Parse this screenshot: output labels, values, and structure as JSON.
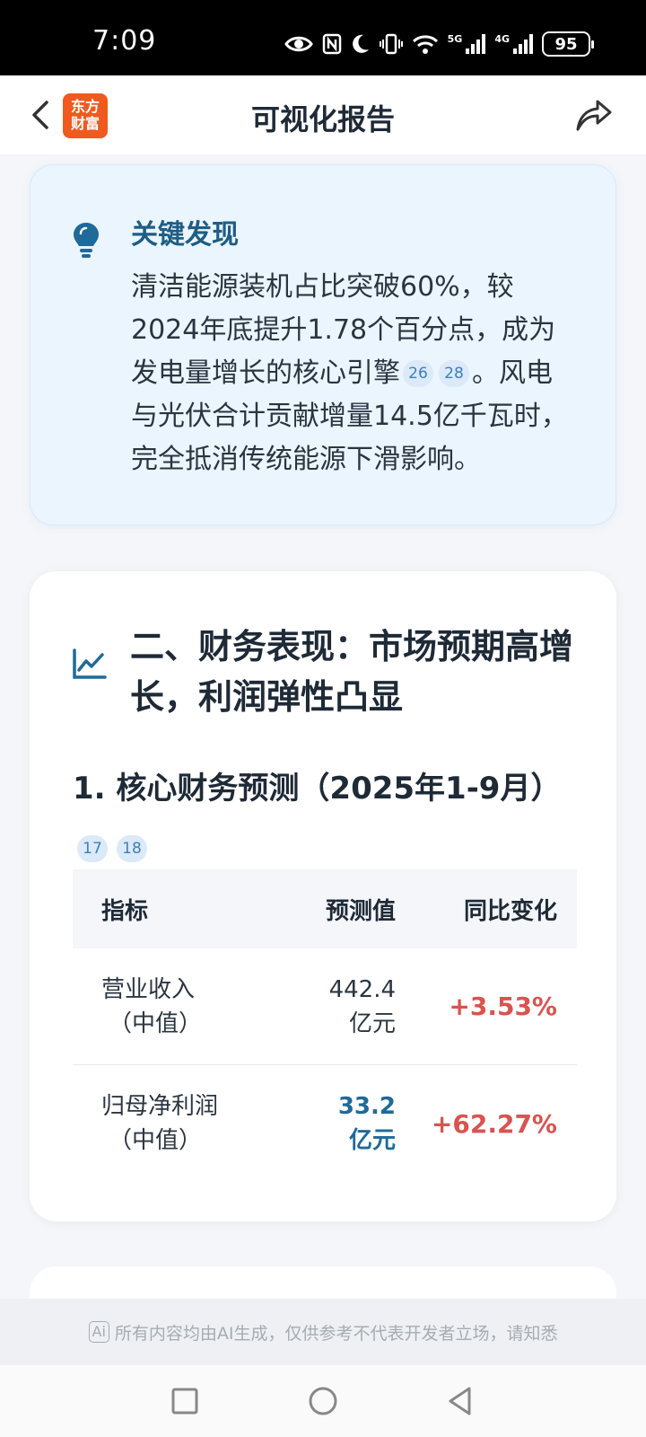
{
  "status_bar": {
    "time": "7:09",
    "signal_1_label": "5G",
    "signal_2_label": "4G",
    "battery": "95"
  },
  "header": {
    "title": "可视化报告",
    "logo_line1": "东方",
    "logo_line2": "财富"
  },
  "key_finding": {
    "title": "关键发现",
    "text_part1": "清洁能源装机占比突破60%，较2024年底提升1.78个百分点，成为发电量增长的核心引擎",
    "citations": [
      "26",
      "28"
    ],
    "text_part2": "。风电与光伏合计贡献增量14.5亿千瓦时，完全抵消传统能源下滑影响。"
  },
  "finance_section": {
    "title": "二、财务表现：市场预期高增长，利润弹性凸显",
    "subtitle": "1. 核心财务预测（2025年1-9月）",
    "citations": [
      "17",
      "18"
    ],
    "table": {
      "headers": [
        "指标",
        "预测值",
        "同比变化"
      ],
      "rows": [
        {
          "metric_line1": "营业收入",
          "metric_line2": "（中值）",
          "value": "442.4亿元",
          "change": "+3.53%"
        },
        {
          "metric_line1": "归母净利润",
          "metric_line2": "（中值）",
          "value": "33.2亿元",
          "change": "+62.27%"
        }
      ]
    }
  },
  "disclaimer": {
    "badge": "Ai",
    "text": "所有内容均由AI生成，仅供参考不代表开发者立场，请知悉"
  },
  "colors": {
    "accent": "#1e6a9a",
    "brand": "#f05a1e",
    "positive": "#d9534f",
    "key_card_bg": "#eaf5fd"
  }
}
